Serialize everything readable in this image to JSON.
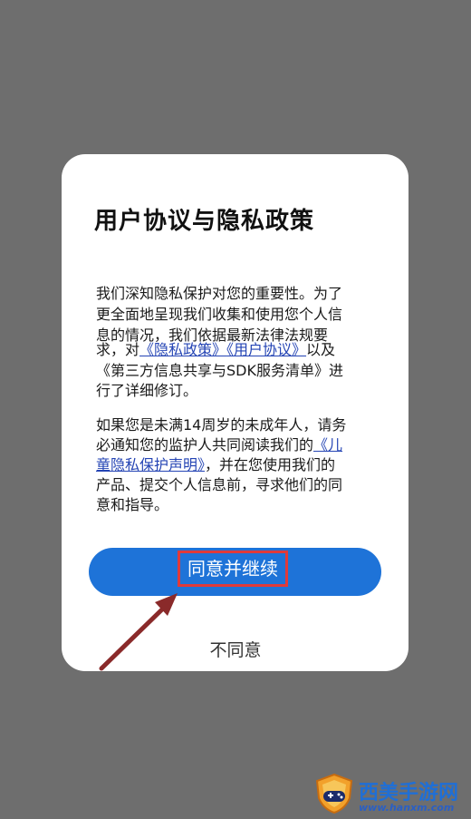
{
  "dialog": {
    "title": "用户协议与隐私政策",
    "paragraph1": {
      "line1": "我们深知隐私保护对您的重要性。为了",
      "line2": "更全面地呈现我们收集和使用您个人信",
      "line3": "息的情况，我们依据最新法律法规要",
      "line4_prefix": "求，对",
      "privacy_link": "《隐私政策》",
      "user_link": "《用户协议》",
      "line4_suffix": "以及",
      "line5": "《第三方信息共享与SDK服务清单》进",
      "line6": "行了详细修订。"
    },
    "paragraph2": {
      "line1": "如果您是未满14周岁的未成年人，请务",
      "line2_prefix": "必通知您的监护人共同阅读我们的",
      "child_link_part1": "《儿",
      "child_link_part2": "童隐私保护声明》",
      "line3_suffix": "，并在您使用我们的",
      "line4": "产品、提交个人信息前，寻求他们的同",
      "line5": "意和指导。"
    },
    "agree_label": "同意并继续",
    "disagree_label": "不同意"
  },
  "watermark": {
    "brand": "西美手游网",
    "url": "www.hanxm.com"
  },
  "colors": {
    "overlay": "#6e6e6e",
    "primary_button": "#1e73d8",
    "highlight_box": "#e03a3a",
    "link": "#2444b4",
    "arrow": "#8a2a2a"
  }
}
